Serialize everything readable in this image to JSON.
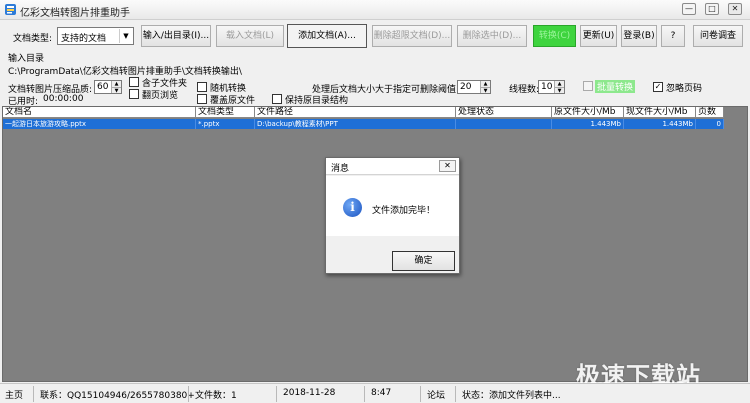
{
  "window": {
    "title": "亿彩文档转图片排重助手",
    "minimize": "—",
    "maximize": "□",
    "close": "✕"
  },
  "toolbar": {
    "doc_type_label": "文档类型:",
    "doc_type_value": "支持的文档",
    "io_dir_button": "输入/出目录(I)...",
    "load_doc_button": "载入文档(L)",
    "add_doc_button": "添加文档(A)...",
    "delete_over_button": "删除超限文档(D)...",
    "delete_selected_button": "删除选中(D)...",
    "convert_button": "转换(C)",
    "update_button": "更新(U)",
    "login_button": "登录(B)",
    "help_button": "?",
    "survey_button": "问卷调查"
  },
  "paths": {
    "input_dir_label": "输入目录",
    "output_path": "C:\\ProgramData\\亿彩文档转图片排重助手\\文档转换输出\\"
  },
  "options": {
    "quality_label": "文档转图片压缩品质:",
    "quality_value": "60",
    "elapsed_label": "已用时:",
    "elapsed_value": "00:00:00",
    "include_subfolders": "含子文件夹",
    "page_preview": "翻页浏览",
    "random_convert": "随机转换",
    "overwrite_original": "覆盖原文件",
    "keep_dir_structure": "保持原目录结构",
    "threshold_label": "处理后文档大小大于指定可删除阈值:",
    "threshold_value": "20",
    "threads_label": "线程数:",
    "threads_value": "10",
    "batch_convert": "批量转换",
    "ignore_page_numbers": "忽略页码"
  },
  "table": {
    "columns": [
      "文档名",
      "文档类型",
      "文件路径",
      "处理状态",
      "原文件大小/Mb",
      "现文件大小/Mb",
      "页数"
    ],
    "rows": [
      {
        "name": "一起游日本旅游攻略.pptx",
        "type": "*.pptx",
        "path": "D:\\backup\\教程素材\\PPT",
        "status": "",
        "orig_size": "1.443Mb",
        "new_size": "1.443Mb",
        "pages": "0"
      }
    ]
  },
  "dialog": {
    "title": "消息",
    "close": "✕",
    "message": "文件添加完毕！",
    "ok_button": "确定"
  },
  "statusbar": {
    "home": "主页",
    "contact": "联系：QQ15104946/2655780380+",
    "file_count": "文件数：1",
    "date": "2018-11-28",
    "time": "8:47",
    "forum": "论坛",
    "status": "状态：添加文件列表中..."
  },
  "watermark": "极速下载站",
  "colors": {
    "selection": "#1e6fd6",
    "convert_green": "#3ed43e",
    "grid_background": "#808080"
  }
}
